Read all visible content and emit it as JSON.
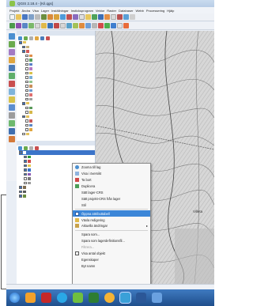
{
  "window": {
    "title": "QGIS 2.18.4 - [Kil.qgs]"
  },
  "menubar": {
    "items": [
      "Projekt",
      "Ändra",
      "Visa",
      "Lager",
      "Inställningar",
      "Insticksprogram",
      "Vektor",
      "Raster",
      "Databaser",
      "Webb",
      "Processering",
      "Hjälp"
    ]
  },
  "context_menu": {
    "items": [
      {
        "label": "Zooma till lag",
        "icon": "zoom-layer-icon",
        "state": "normal"
      },
      {
        "label": "Visa i översikt",
        "icon": "overview-icon",
        "state": "normal"
      },
      {
        "label": "Ta bort",
        "icon": "remove-icon",
        "state": "normal"
      },
      {
        "label": "Duplicera",
        "icon": "duplicate-icon",
        "state": "normal"
      },
      {
        "label": "Sätt lager-CRS",
        "icon": "",
        "state": "normal"
      },
      {
        "label": "Sätt projekt-CRS från lager",
        "icon": "",
        "state": "normal"
      },
      {
        "label": "Stil",
        "icon": "",
        "state": "normal"
      },
      {
        "label": "Öppna attributtabell",
        "icon": "attribute-table-icon",
        "state": "highlighted"
      },
      {
        "label": "Växla redigering",
        "icon": "edit-pencil-icon",
        "state": "normal"
      },
      {
        "label": "Aktuella ändringar",
        "icon": "edits-icon",
        "state": "submenu"
      },
      {
        "label": "Spara som...",
        "icon": "",
        "state": "normal"
      },
      {
        "label": "Spara som lagerdefinitionsfil...",
        "icon": "",
        "state": "normal"
      },
      {
        "label": "Filtrera...",
        "icon": "",
        "state": "disabled"
      },
      {
        "label": "Visa antal objekt",
        "icon": "checkbox-icon",
        "state": "normal"
      },
      {
        "label": "Egenskaper",
        "icon": "",
        "state": "normal"
      },
      {
        "label": "Byt namn",
        "icon": "",
        "state": "normal"
      }
    ]
  },
  "map": {
    "label": "Villeta"
  },
  "colors": {
    "accent": "#3b86d8",
    "selection": "#3b74c9",
    "taskbar": "#1f4f8c"
  }
}
